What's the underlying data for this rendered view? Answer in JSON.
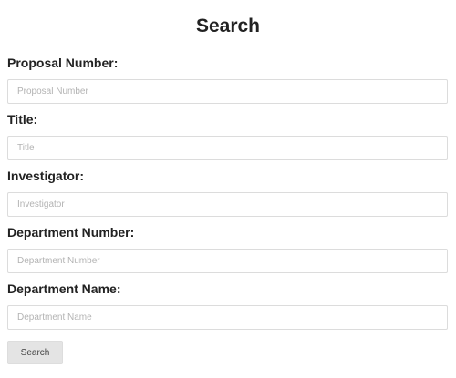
{
  "page": {
    "title": "Search"
  },
  "form": {
    "fields": [
      {
        "label": "Proposal Number:",
        "placeholder": "Proposal Number",
        "value": ""
      },
      {
        "label": "Title:",
        "placeholder": "Title",
        "value": ""
      },
      {
        "label": "Investigator:",
        "placeholder": "Investigator",
        "value": ""
      },
      {
        "label": "Department Number:",
        "placeholder": "Department Number",
        "value": ""
      },
      {
        "label": "Department Name:",
        "placeholder": "Department Name",
        "value": ""
      }
    ],
    "submit_label": "Search"
  },
  "colors": {
    "heading_text": "#222222",
    "input_border": "#dcdcdc",
    "placeholder_text": "#b3b3b3",
    "button_background": "#e4e4e4"
  }
}
